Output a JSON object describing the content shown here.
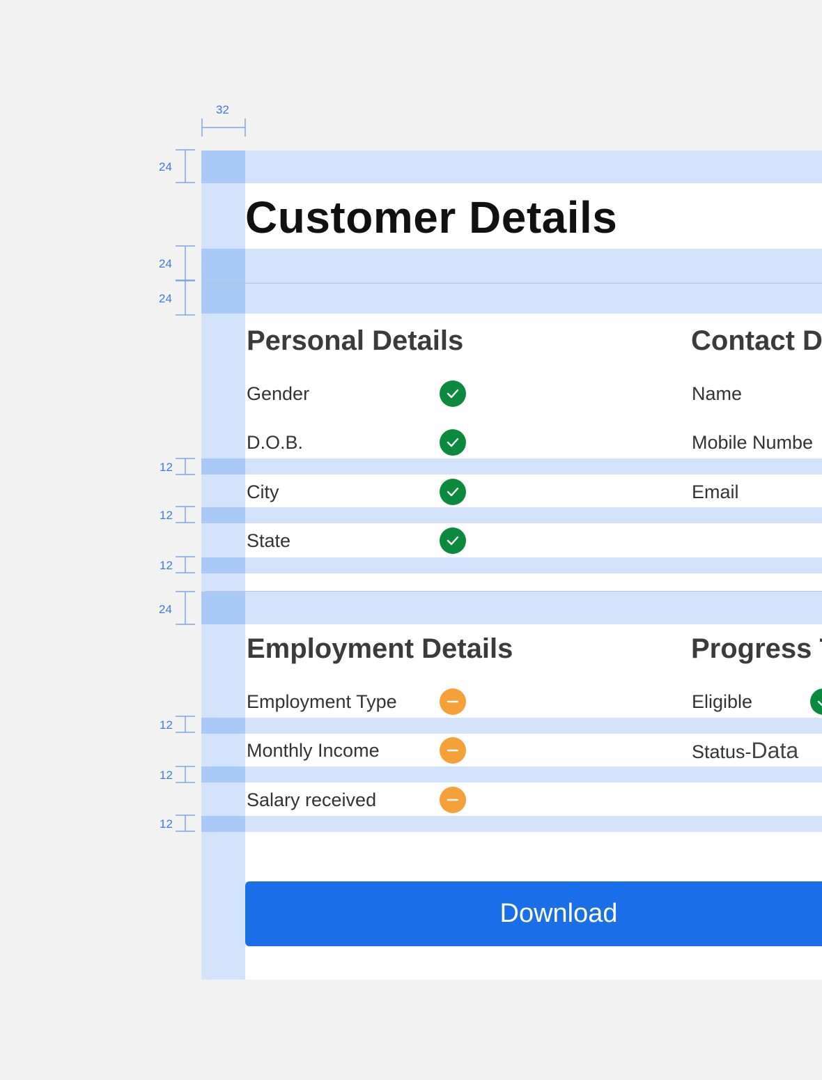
{
  "page": {
    "title": "Customer Details"
  },
  "spacing_annotations": {
    "column_width": "32",
    "rows": [
      "24",
      "24",
      "24",
      "12",
      "12",
      "12",
      "24",
      "12",
      "12",
      "12"
    ]
  },
  "personal_details": {
    "heading": "Personal Details",
    "items": [
      {
        "label": "Gender",
        "status": "complete"
      },
      {
        "label": "D.O.B.",
        "status": "complete"
      },
      {
        "label": "City",
        "status": "complete"
      },
      {
        "label": "State",
        "status": "complete"
      }
    ]
  },
  "contact_details": {
    "heading": "Contact D",
    "items": [
      {
        "label": "Name"
      },
      {
        "label": "Mobile Numbe"
      },
      {
        "label": "Email"
      }
    ]
  },
  "employment_details": {
    "heading": "Employment Details",
    "items": [
      {
        "label": "Employment Type",
        "status": "pending"
      },
      {
        "label": "Monthly Income",
        "status": "pending"
      },
      {
        "label": "Salary received",
        "status": "pending"
      }
    ]
  },
  "progress": {
    "heading": "Progress T",
    "eligible_label": "Eligible",
    "status_label": "Status-",
    "status_value": "Data"
  },
  "actions": {
    "download_label": "Download"
  },
  "colors": {
    "background": "#f2f2f2",
    "guide_band": "#d2e3fb",
    "guide_band_edge": "#a9c9f6",
    "annotation": "#3d7be0",
    "status_complete": "#0b8a3e",
    "status_pending": "#f6a03a",
    "primary_button": "#1a6fe8"
  },
  "icons": {
    "complete": "check-circle-icon",
    "pending": "minus-circle-icon"
  }
}
